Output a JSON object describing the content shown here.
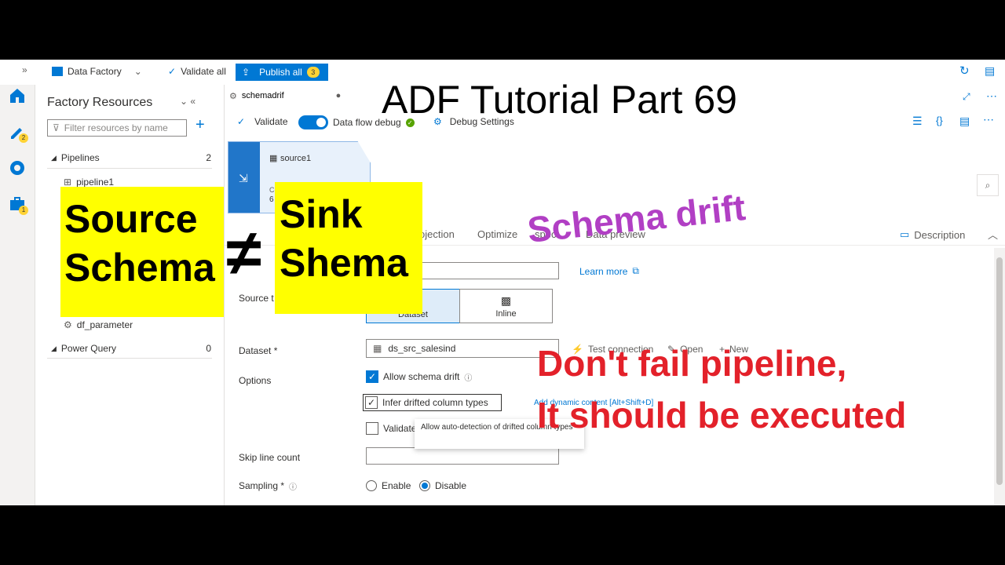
{
  "topbar": {
    "app_name": "Data Factory",
    "validate_all": "Validate all",
    "publish_all": "Publish all",
    "publish_count": "3"
  },
  "leftnav": {
    "author_badge": "2",
    "manage_badge": "1"
  },
  "resources": {
    "title": "Factory Resources",
    "filter_placeholder": "Filter resources by name",
    "pipelines_label": "Pipelines",
    "pipelines_count": "2",
    "pipeline1": "pipeline1",
    "df_parameter": "df_parameter",
    "power_query_label": "Power Query",
    "power_query_count": "0"
  },
  "canvas": {
    "tab_name": "schemadrif",
    "validate": "Validate",
    "dataflow_debug": "Data flow debug",
    "debug_settings": "Debug Settings",
    "node_name": "source1",
    "node_sub": "Co",
    "node_num": "6"
  },
  "props": {
    "tab_projection": "ojection",
    "tab_optimize": "Optimize",
    "tab_inspect": "spect",
    "tab_preview": "Data preview",
    "description": "Description",
    "learn_more": "Learn more",
    "source_type_label": "Source t",
    "dataset_option": "Dataset",
    "inline_option": "Inline",
    "dataset_label": "Dataset *",
    "dataset_value": "ds_src_salesind",
    "test_connection": "Test connection",
    "open": "Open",
    "new": "New",
    "options_label": "Options",
    "allow_schema_drift": "Allow schema drift",
    "infer_drifted": "Infer drifted column types",
    "validate_schema": "Validate",
    "dynamic_content": "Add dynamic content [Alt+Shift+D]",
    "tooltip": "Allow auto-detection of drifted column types",
    "skip_line_label": "Skip line count",
    "sampling_label": "Sampling *",
    "enable": "Enable",
    "disable": "Disable"
  },
  "overlay": {
    "title": "ADF Tutorial Part 69",
    "source_schema_1": "Source",
    "source_schema_2": "Schema",
    "not_equal": "≠",
    "sink_schema_1": "Sink",
    "sink_schema_2": "Shema",
    "schema_drift": "Schema drift",
    "red_line1": "Don't fail pipeline,",
    "red_line2": "It should be executed"
  },
  "colors": {
    "accent": "#0078d4",
    "overlay_yellow": "#ffff00",
    "overlay_purple": "#b13fc4",
    "overlay_red": "#e3212a"
  }
}
